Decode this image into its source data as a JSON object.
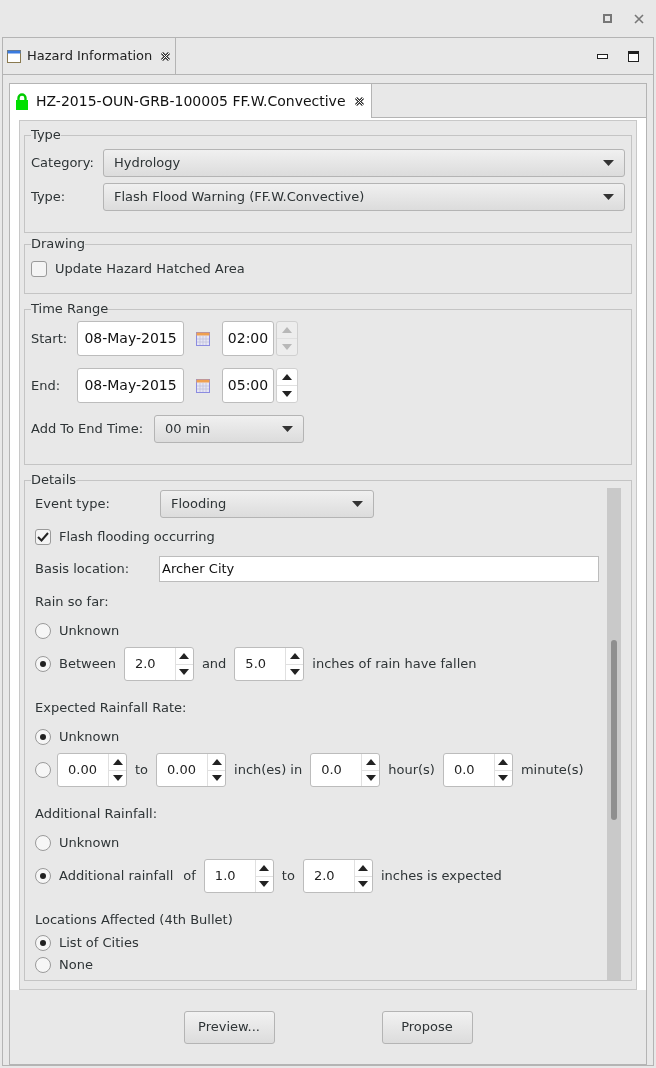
{
  "view_tab": {
    "title": "Hazard Information"
  },
  "hazard_tab": {
    "title": "HZ-2015-OUN-GRB-100005 FF.W.Convective",
    "locked": true
  },
  "type_group": {
    "title": "Type",
    "fields": [
      {
        "label": "Category:",
        "value": "Hydrology"
      },
      {
        "label": "Type:",
        "value": "Flash Flood Warning (FF.W.Convective)"
      }
    ]
  },
  "drawing_group": {
    "title": "Drawing",
    "checkbox": {
      "label": "Update Hazard Hatched Area",
      "checked": false
    }
  },
  "time_range": {
    "title": "Time Range",
    "rows": [
      {
        "label": "Start:",
        "date": "08-May-2015",
        "time": "02:00",
        "spinner_disabled": true
      },
      {
        "label": "End:",
        "date": "08-May-2015",
        "time": "05:00",
        "spinner_disabled": false
      }
    ],
    "add_to_end": {
      "label": "Add To End Time:",
      "value": "00 min"
    }
  },
  "details": {
    "title": "Details",
    "items": [
      {
        "kind": "combo",
        "label": "Event type:",
        "value": "Flooding"
      },
      {
        "kind": "checkbox",
        "label": "Flash flooding occurring",
        "checked": true
      },
      {
        "kind": "text",
        "label": "Basis location:",
        "value": "Archer City"
      },
      {
        "kind": "radio_group",
        "title": "Rain so far:",
        "options": [
          {
            "selected": false,
            "parts": [
              {
                "kind": "label",
                "text": "Unknown"
              }
            ]
          },
          {
            "selected": true,
            "parts": [
              {
                "kind": "label",
                "text": "Between"
              },
              {
                "kind": "spinner",
                "value": "2.0"
              },
              {
                "kind": "label",
                "text": "and"
              },
              {
                "kind": "spinner",
                "value": "5.0"
              },
              {
                "kind": "label",
                "text": "inches of rain have fallen"
              }
            ]
          }
        ]
      },
      {
        "kind": "radio_group",
        "title": "Expected Rainfall Rate:",
        "options": [
          {
            "selected": true,
            "parts": [
              {
                "kind": "label",
                "text": "Unknown"
              }
            ]
          },
          {
            "selected": false,
            "parts": [
              {
                "kind": "spinner",
                "value": "0.00"
              },
              {
                "kind": "label",
                "text": "to"
              },
              {
                "kind": "spinner",
                "value": "0.00"
              },
              {
                "kind": "label",
                "text": "inch(es) in"
              },
              {
                "kind": "spinner",
                "value": "0.0"
              },
              {
                "kind": "label",
                "text": "hour(s)"
              },
              {
                "kind": "spinner",
                "value": "0.0"
              },
              {
                "kind": "label",
                "text": "minute(s)"
              }
            ]
          }
        ]
      },
      {
        "kind": "radio_group",
        "title": "Additional Rainfall:",
        "options": [
          {
            "selected": false,
            "parts": [
              {
                "kind": "label",
                "text": "Unknown"
              }
            ]
          },
          {
            "selected": true,
            "parts": [
              {
                "kind": "label",
                "text": "Additional rainfall"
              },
              {
                "kind": "label",
                "text": "of"
              },
              {
                "kind": "spinner",
                "value": "1.0"
              },
              {
                "kind": "label",
                "text": "to"
              },
              {
                "kind": "spinner",
                "value": "2.0"
              },
              {
                "kind": "label",
                "text": "inches is expected"
              }
            ]
          }
        ]
      },
      {
        "kind": "radio_list",
        "title": "Locations Affected (4th Bullet)",
        "options": [
          {
            "selected": true,
            "parts": [
              {
                "kind": "label",
                "text": "List of Cities"
              }
            ]
          },
          {
            "selected": false,
            "parts": [
              {
                "kind": "label",
                "text": "None"
              }
            ]
          }
        ]
      }
    ]
  },
  "buttons": [
    "Preview...",
    "Propose"
  ]
}
